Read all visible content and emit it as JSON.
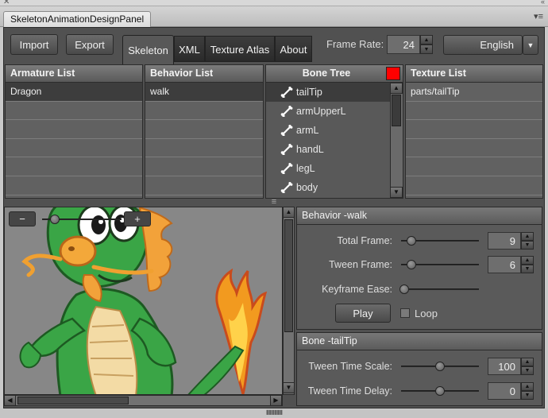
{
  "window": {
    "title": "SkeletonAnimationDesignPanel",
    "close_glyph": "✕",
    "collapse_glyph": "«",
    "menu_glyph": "▾≡"
  },
  "toolbar": {
    "import_label": "Import",
    "export_label": "Export",
    "tabs": [
      {
        "label": "Skeleton",
        "active": true
      },
      {
        "label": "XML",
        "active": false
      },
      {
        "label": "Texture Atlas",
        "active": false
      },
      {
        "label": "About",
        "active": false
      }
    ],
    "frame_rate_label": "Frame Rate:",
    "frame_rate_value": "24",
    "language": "English"
  },
  "armature_list": {
    "header": "Armature List",
    "items": [
      "Dragon"
    ],
    "selected": 0
  },
  "behavior_list": {
    "header": "Behavior List",
    "items": [
      "walk"
    ],
    "selected": 0
  },
  "bone_tree": {
    "header": "Bone Tree",
    "color_swatch": "#ff0000",
    "items": [
      "tailTip",
      "armUpperL",
      "armL",
      "handL",
      "legL",
      "body"
    ],
    "selected": 0
  },
  "texture_list": {
    "header": "Texture List",
    "items": [
      "parts/tailTip"
    ],
    "selected": 0
  },
  "divider_grip": "≡",
  "zoom": {
    "minus_label": "−",
    "plus_label": "+",
    "level": 0.1
  },
  "behavior_panel": {
    "header": "Behavior -walk",
    "total_frame_label": "Total Frame:",
    "total_frame_value": "9",
    "total_frame_level": 0.05,
    "tween_frame_label": "Tween Frame:",
    "tween_frame_value": "6",
    "tween_frame_level": 0.05,
    "keyframe_ease_label": "Keyframe Ease:",
    "keyframe_ease_level": 0.0,
    "play_label": "Play",
    "loop_label": "Loop",
    "loop_checked": false
  },
  "bone_panel": {
    "header": "Bone -tailTip",
    "tween_time_scale_label": "Tween Time Scale:",
    "tween_time_scale_value": "100",
    "tween_time_scale_level": 0.5,
    "tween_time_delay_label": "Tween Time Delay:",
    "tween_time_delay_value": "0",
    "tween_time_delay_level": 0.5
  },
  "colors": {
    "panel_bg": "#515151",
    "swatch_red": "#ff0000",
    "dragon_green": "#3aa546"
  },
  "icons": {
    "bone": "bone-icon",
    "up": "arrow-up-icon",
    "down": "arrow-down-icon",
    "left": "arrow-left-icon",
    "right": "arrow-right-icon"
  }
}
